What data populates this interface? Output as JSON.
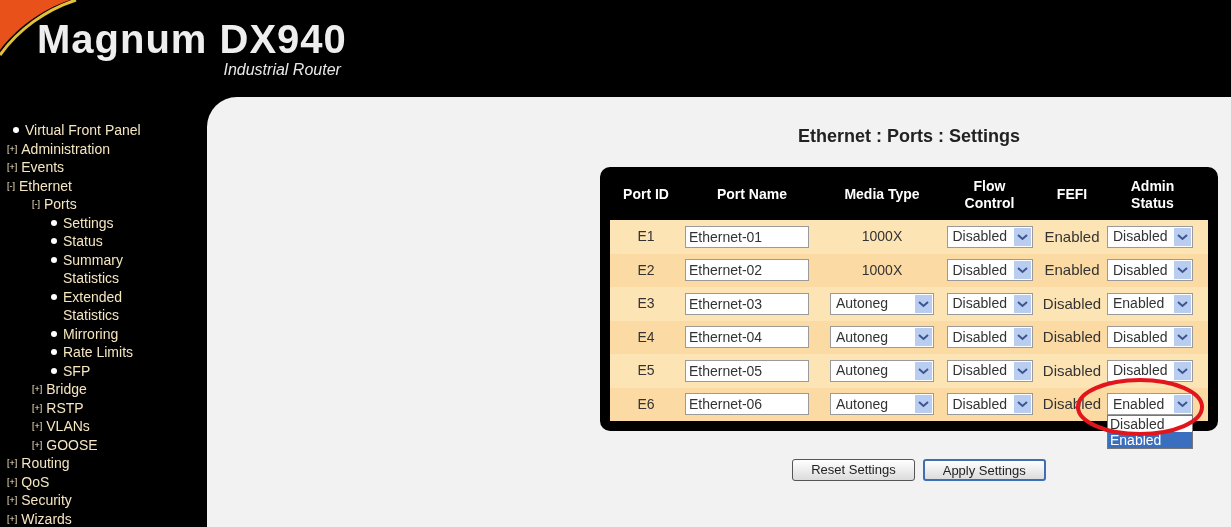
{
  "header": {
    "title": "Magnum DX940",
    "subtitle": "Industrial Router"
  },
  "sidebar": {
    "items": [
      {
        "label": "Virtual Front Panel"
      },
      {
        "marker": "[+]",
        "label": "Administration"
      },
      {
        "marker": "[+]",
        "label": "Events"
      },
      {
        "marker": "[-]",
        "label": "Ethernet",
        "children": [
          {
            "marker": "[-]",
            "label": "Ports",
            "children": [
              {
                "label": "Settings"
              },
              {
                "label": "Status"
              },
              {
                "label": "Summary Statistics"
              },
              {
                "label": "Extended Statistics"
              },
              {
                "label": "Mirroring"
              },
              {
                "label": "Rate Limits"
              },
              {
                "label": "SFP"
              }
            ]
          },
          {
            "marker": "[+]",
            "label": "Bridge"
          },
          {
            "marker": "[+]",
            "label": "RSTP"
          },
          {
            "marker": "[+]",
            "label": "VLANs"
          },
          {
            "marker": "[+]",
            "label": "GOOSE"
          }
        ]
      },
      {
        "marker": "[+]",
        "label": "Routing"
      },
      {
        "marker": "[+]",
        "label": "QoS"
      },
      {
        "marker": "[+]",
        "label": "Security"
      },
      {
        "marker": "[+]",
        "label": "Wizards"
      }
    ]
  },
  "page_title": "Ethernet : Ports : Settings",
  "table": {
    "columns": [
      "Port ID",
      "Port Name",
      "Media Type",
      "Flow Control",
      "FEFI",
      "Admin Status"
    ],
    "rows": [
      {
        "port_id": "E1",
        "port_name": "Ethernet-01",
        "media_type": {
          "kind": "text",
          "value": "1000X"
        },
        "flow_control": "Disabled",
        "fefi": "Enabled",
        "admin_status": {
          "value": "Disabled",
          "open": false
        }
      },
      {
        "port_id": "E2",
        "port_name": "Ethernet-02",
        "media_type": {
          "kind": "text",
          "value": "1000X"
        },
        "flow_control": "Disabled",
        "fefi": "Enabled",
        "admin_status": {
          "value": "Disabled",
          "open": false
        }
      },
      {
        "port_id": "E3",
        "port_name": "Ethernet-03",
        "media_type": {
          "kind": "select",
          "value": "Autoneg"
        },
        "flow_control": "Disabled",
        "fefi": "Disabled",
        "admin_status": {
          "value": "Enabled",
          "open": false
        }
      },
      {
        "port_id": "E4",
        "port_name": "Ethernet-04",
        "media_type": {
          "kind": "select",
          "value": "Autoneg"
        },
        "flow_control": "Disabled",
        "fefi": "Disabled",
        "admin_status": {
          "value": "Disabled",
          "open": false
        }
      },
      {
        "port_id": "E5",
        "port_name": "Ethernet-05",
        "media_type": {
          "kind": "select",
          "value": "Autoneg"
        },
        "flow_control": "Disabled",
        "fefi": "Disabled",
        "admin_status": {
          "value": "Disabled",
          "open": false
        }
      },
      {
        "port_id": "E6",
        "port_name": "Ethernet-06",
        "media_type": {
          "kind": "select",
          "value": "Autoneg"
        },
        "flow_control": "Disabled",
        "fefi": "Disabled",
        "admin_status": {
          "value": "Enabled",
          "open": true,
          "options": [
            {
              "label": "Disabled",
              "selected": false
            },
            {
              "label": "Enabled",
              "selected": true
            }
          ]
        }
      }
    ]
  },
  "buttons": [
    "Reset Settings",
    "Apply Settings"
  ]
}
